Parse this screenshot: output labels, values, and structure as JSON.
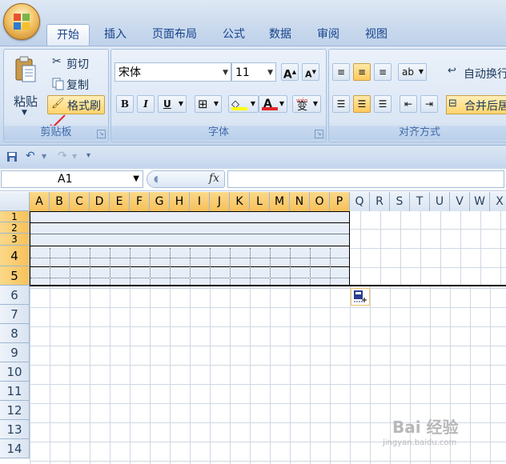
{
  "tabs": [
    "开始",
    "插入",
    "页面布局",
    "公式",
    "数据",
    "审阅",
    "视图"
  ],
  "active_tab": "开始",
  "clipboard": {
    "paste_label": "粘贴",
    "cut_label": "剪切",
    "copy_label": "复制",
    "format_painter_label": "格式刷",
    "group_label": "剪贴板"
  },
  "font": {
    "font_name": "宋体",
    "font_size": "11",
    "group_label": "字体",
    "grow_label": "A",
    "shrink_label": "A",
    "bold_label": "B",
    "italic_label": "I",
    "underline_label": "U",
    "font_color_label": "A",
    "phonetic_label": "变",
    "phonetic_sup": "wén"
  },
  "alignment": {
    "group_label": "对齐方式",
    "wrap_text_label": "自动换行",
    "merge_center_label": "合并后居"
  },
  "name_box": {
    "value": "A1"
  },
  "fx_label": "fx",
  "columns": [
    "A",
    "B",
    "C",
    "D",
    "E",
    "F",
    "G",
    "H",
    "I",
    "J",
    "K",
    "L",
    "M",
    "N",
    "O",
    "P",
    "Q",
    "R",
    "S",
    "T",
    "U",
    "V",
    "W",
    "X"
  ],
  "rows": [
    "1",
    "2",
    "3",
    "4",
    "5",
    "6",
    "7",
    "8",
    "9",
    "10",
    "11",
    "12",
    "13",
    "14"
  ],
  "selection": {
    "range": "A1:P5"
  },
  "watermark": {
    "text": "Bai 经验",
    "url": "jingyan.baidu.com"
  },
  "colors": {
    "accent": "#f7c15a",
    "ribbon": "#d3e1f1",
    "arrow": "#e3272b"
  }
}
